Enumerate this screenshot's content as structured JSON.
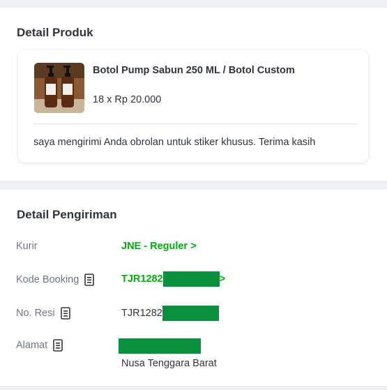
{
  "detail_produk": {
    "title": "Detail Produk",
    "product_name": "Botol Pump Sabun 250 ML / Botol Custom",
    "quantity_price": "18 x Rp 20.000",
    "note": "saya mengirimi Anda obrolan untuk stiker khusus. Terima kasih"
  },
  "detail_pengiriman": {
    "title": "Detail Pengiriman",
    "kurir_label": "Kurir",
    "kurir_value": "JNE - Reguler >",
    "kode_booking_label": "Kode Booking",
    "kode_booking_value": "TJR1282",
    "kode_booking_suffix": ">",
    "no_resi_label": "No. Resi",
    "no_resi_value": "TJR1282",
    "alamat_label": "Alamat",
    "alamat_region": "Nusa Tenggara Barat"
  },
  "icons": {
    "copy": "copy-icon",
    "chevron": "chevron-right-icon"
  },
  "colors": {
    "accent_green": "#03ac0e",
    "redaction": "#0a8f3f",
    "section_band": "#eef0f4"
  }
}
